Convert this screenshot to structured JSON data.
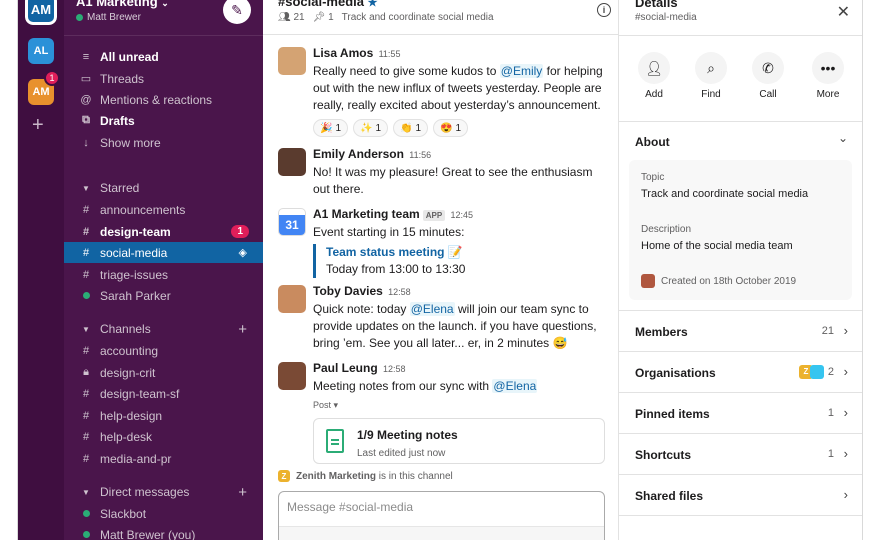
{
  "workspace_rail": {
    "active": "AM",
    "others": [
      "AL",
      "AM"
    ],
    "badge_count": "1"
  },
  "sidebar": {
    "workspace_name": "A1 Marketing",
    "user_name": "Matt Brewer",
    "nav": [
      {
        "label": "All unread",
        "icon": "all-unread-icon"
      },
      {
        "label": "Threads",
        "icon": "threads-icon"
      },
      {
        "label": "Mentions & reactions",
        "icon": "at-icon"
      },
      {
        "label": "Drafts",
        "icon": "drafts-icon"
      },
      {
        "label": "Show more",
        "icon": "arrow-down-icon"
      }
    ],
    "starred_header": "Starred",
    "starred": [
      {
        "label": "announcements"
      },
      {
        "label": "design-team",
        "badge": "1"
      },
      {
        "label": "social-media"
      },
      {
        "label": "triage-issues"
      },
      {
        "label": "Sarah Parker"
      }
    ],
    "channels_header": "Channels",
    "channels": [
      "accounting",
      "design-crit",
      "design-team-sf",
      "help-design",
      "help-desk",
      "media-and-pr"
    ],
    "dm_header": "Direct messages",
    "dms": [
      "Slackbot",
      "Matt Brewer (you)"
    ]
  },
  "channel": {
    "name": "#social-media",
    "member_count": "21",
    "pinned_count": "1",
    "topic": "Track and coordinate social media",
    "messages": [
      {
        "author": "Lisa Amos",
        "time": "11:55",
        "text_before": "Really need to give some kudos to ",
        "mention": "@Emily",
        "text_after": " for helping out with the new influx of tweets yesterday. People are really, really excited about yesterday’s announcement.",
        "reactions": [
          {
            "emoji": "🎉",
            "count": "1"
          },
          {
            "emoji": "✨",
            "count": "1"
          },
          {
            "emoji": "👏",
            "count": "1"
          },
          {
            "emoji": "😍",
            "count": "1"
          }
        ]
      },
      {
        "author": "Emily Anderson",
        "time": "11:56",
        "text": "No! It was my pleasure! Great to see the enthusiasm out there."
      },
      {
        "author": "A1 Marketing team",
        "app_tag": "APP",
        "time": "12:45",
        "text": "Event starting in 15 minutes:",
        "event_title": "Team status meeting",
        "event_emoji": "📝",
        "event_time": "Today from 13:00 to 13:30",
        "calendar_day": "31"
      },
      {
        "author": "Toby Davies",
        "time": "12:58",
        "text_before": "Quick note: today ",
        "mention": "@Elena",
        "text_after": " will join our team sync to provide updates on the launch. if you have questions, bring ’em. See you all later... er, in 2 minutes 😅"
      },
      {
        "author": "Paul Leung",
        "time": "12:58",
        "text_before": "Meeting notes from our sync with ",
        "mention": "@Elena",
        "post_label": "Post ▾",
        "post_title": "1/9 Meeting notes",
        "post_sub": "Last edited just now"
      }
    ],
    "zenith_name": "Zenith Marketing",
    "zenith_text": " is in this channel",
    "composer_placeholder": "Message #social-media"
  },
  "details": {
    "title": "Details",
    "subtitle": "#social-media",
    "actions": [
      "Add",
      "Find",
      "Call",
      "More"
    ],
    "about_header": "About",
    "topic_label": "Topic",
    "topic_value": "Track and coordinate social media",
    "description_label": "Description",
    "description_value": "Home of the social media team",
    "created": "Created on 18th October 2019",
    "rows": [
      {
        "label": "Members",
        "count": "21"
      },
      {
        "label": "Organisations",
        "count": "2"
      },
      {
        "label": "Pinned items",
        "count": "1"
      },
      {
        "label": "Shortcuts",
        "count": "1"
      },
      {
        "label": "Shared files",
        "count": ""
      }
    ]
  }
}
